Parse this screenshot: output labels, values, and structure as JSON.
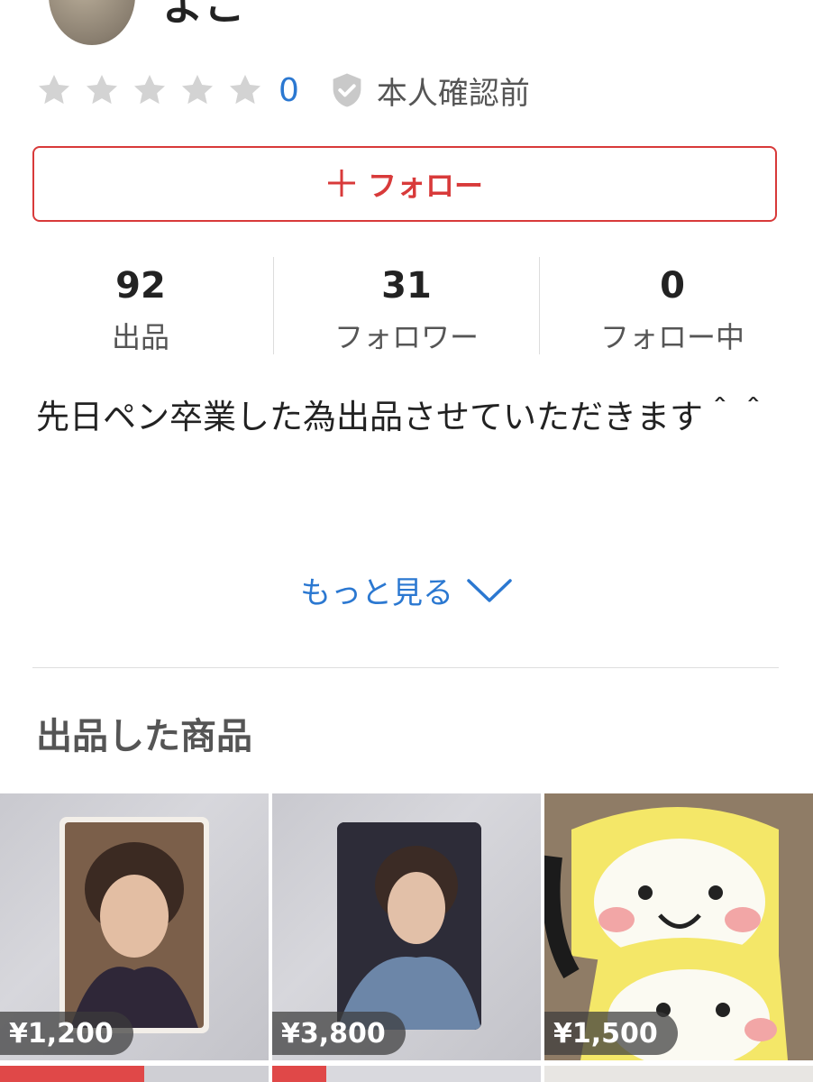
{
  "profile": {
    "username": "よこ",
    "rating_count": "0",
    "verification_label": "本人確認前"
  },
  "follow_button": {
    "label": "フォロー"
  },
  "stats": [
    {
      "value": "92",
      "label": "出品"
    },
    {
      "value": "31",
      "label": "フォロワー"
    },
    {
      "value": "0",
      "label": "フォロー中"
    }
  ],
  "bio": {
    "text": "先日ペン卒業した為出品させていただきます＾＾"
  },
  "more_link": {
    "label": "もっと見る"
  },
  "section": {
    "title": "出品した商品"
  },
  "items": [
    {
      "price": "¥1,200"
    },
    {
      "price": "¥3,800"
    },
    {
      "price": "¥1,500"
    }
  ],
  "icons": {
    "star": "star-icon",
    "shield": "shield-check-icon",
    "plus": "plus-icon",
    "chevron": "chevron-down-icon"
  },
  "colors": {
    "accent_red": "#d83a3a",
    "link_blue": "#2b78d1",
    "star_gray": "#d3d3d3"
  }
}
